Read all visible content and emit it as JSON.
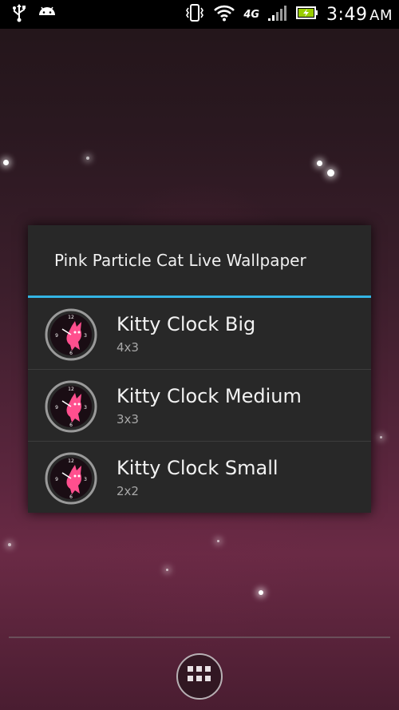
{
  "status_bar": {
    "time": "3:49",
    "am_pm": "AM",
    "network_type": "4G",
    "icons": [
      "usb-icon",
      "android-icon",
      "vibrate-icon",
      "wifi-icon",
      "signal-icon",
      "battery-charging-icon"
    ]
  },
  "dialog": {
    "title": "Pink Particle Cat Live Wallpaper",
    "items": [
      {
        "name": "Kitty Clock Big",
        "size": "4x3",
        "icon": "kitty-clock-icon"
      },
      {
        "name": "Kitty Clock Medium",
        "size": "3x3",
        "icon": "kitty-clock-icon"
      },
      {
        "name": "Kitty Clock Small",
        "size": "2x2",
        "icon": "kitty-clock-icon"
      }
    ]
  },
  "dock": {
    "apps_button_icon": "app-drawer-grid-icon"
  },
  "colors": {
    "accent": "#33b5e5",
    "dialog_bg": "#282828",
    "battery": "#99cc00"
  }
}
